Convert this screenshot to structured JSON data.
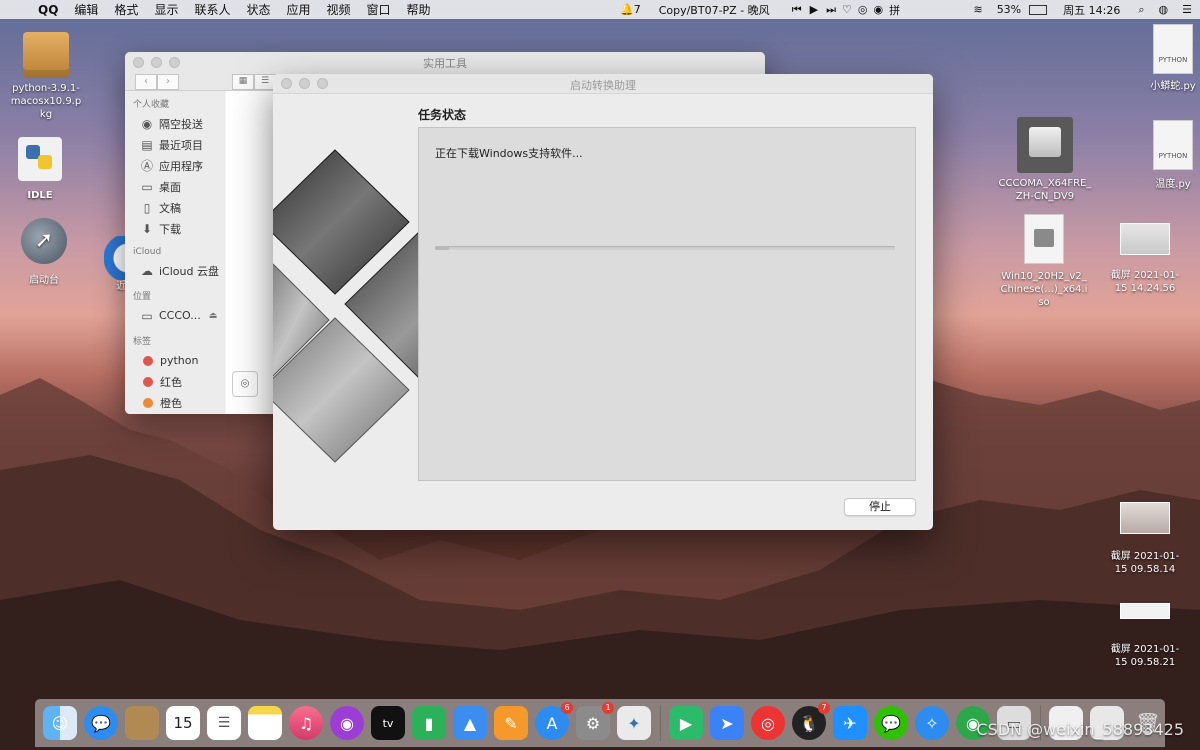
{
  "menubar": {
    "app_name": "QQ",
    "menus": [
      "编辑",
      "格式",
      "显示",
      "联系人",
      "状态",
      "应用",
      "视频",
      "窗口",
      "帮助"
    ],
    "notification_count": "7",
    "now_playing": "Copy/BT07-PZ - 晚风",
    "battery": "53%",
    "clock": "周五 14:26"
  },
  "desktop_icons": [
    {
      "label": "python-3.9.1-macosx10.9.pkg"
    },
    {
      "label": "IDLE"
    },
    {
      "label": "启动台"
    },
    {
      "label": "近"
    },
    {
      "label": "小蟒蛇.py"
    },
    {
      "label": "CCCOMA_X64FRE_ZH-CN_DV9"
    },
    {
      "label": "温度.py"
    },
    {
      "label": "Win10_20H2_v2_Chinese(...)_x64.iso"
    },
    {
      "label": "截屏 2021-01-15 14.24.56"
    },
    {
      "label": "截屏 2021-01-15 09.58.14"
    },
    {
      "label": "截屏 2021-01-15 09.58.21"
    }
  ],
  "doc_ext": "PYTHON",
  "finder": {
    "title": "实用工具",
    "sections": {
      "favorites": "个人收藏",
      "icloud": "iCloud",
      "locations": "位置",
      "tags": "标签"
    },
    "favorites": [
      "隔空投送",
      "最近项目",
      "应用程序",
      "桌面",
      "文稿",
      "下载"
    ],
    "icloud_items": [
      "iCloud 云盘"
    ],
    "locations": [
      "CCCO..."
    ],
    "tags": [
      "python",
      "红色",
      "橙色"
    ]
  },
  "bootcamp": {
    "title": "启动转换助理",
    "heading": "任务状态",
    "status": "正在下载Windows支持软件...",
    "progress": 0.03,
    "stop_label": "停止"
  },
  "dock": {
    "calendar_day": "15",
    "appstore_badge": "6",
    "settings_badge": "1",
    "qq_badge": "7"
  },
  "watermark": "CSDN @weixin_58893425"
}
